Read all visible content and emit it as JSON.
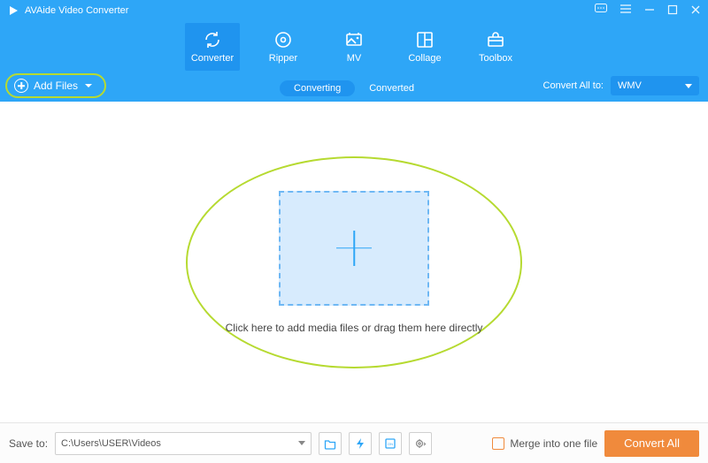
{
  "app": {
    "title": "AVAide Video Converter"
  },
  "tabs": [
    {
      "label": "Converter"
    },
    {
      "label": "Ripper"
    },
    {
      "label": "MV"
    },
    {
      "label": "Collage"
    },
    {
      "label": "Toolbox"
    }
  ],
  "active_tab": 0,
  "add_files": {
    "label": "Add Files"
  },
  "segments": {
    "converting": "Converting",
    "converted": "Converted",
    "active": "converting"
  },
  "convert_all_to": {
    "label": "Convert All to:",
    "value": "WMV"
  },
  "dropzone": {
    "hint": "Click here to add media files or drag them here directly"
  },
  "footer": {
    "save_to_label": "Save to:",
    "save_to_path": "C:\\Users\\USER\\Videos",
    "merge_label": "Merge into one file",
    "merge_checked": false,
    "convert_all_label": "Convert All"
  },
  "colors": {
    "accent": "#2ea6f7",
    "highlight": "#b6da31",
    "cta": "#f08a3c"
  }
}
